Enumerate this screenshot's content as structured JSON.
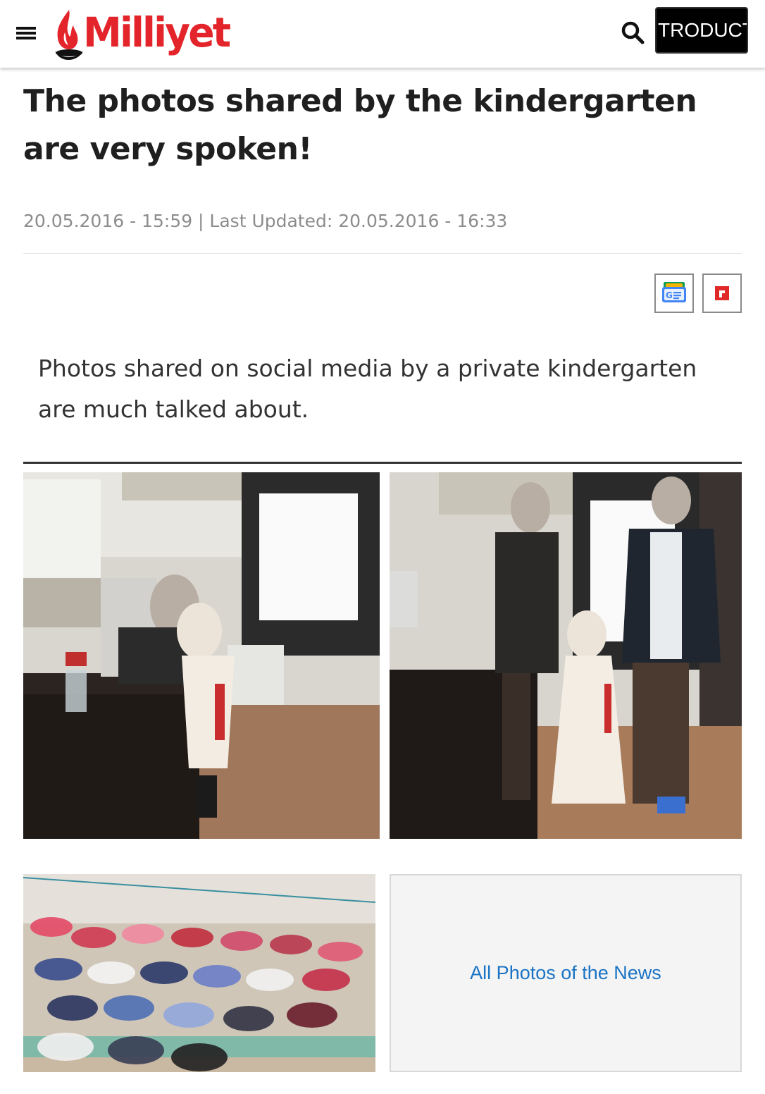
{
  "header": {
    "logo_text": "Milliyet",
    "intro_button": "TRODUCT",
    "brand_color": "#e3242b"
  },
  "article": {
    "headline": "The photos shared by the kindergarten are very spoken!",
    "meta": "20.05.2016 - 15:59 | Last Updated: 20.05.2016 - 16:33",
    "summary": "Photos shared on social media by a private kindergarten are much talked about.",
    "share_buttons": [
      "google-news-icon",
      "flipboard-icon"
    ]
  },
  "gallery": {
    "all_photos_link": "All Photos of the News",
    "link_color": "#1a73c5"
  }
}
